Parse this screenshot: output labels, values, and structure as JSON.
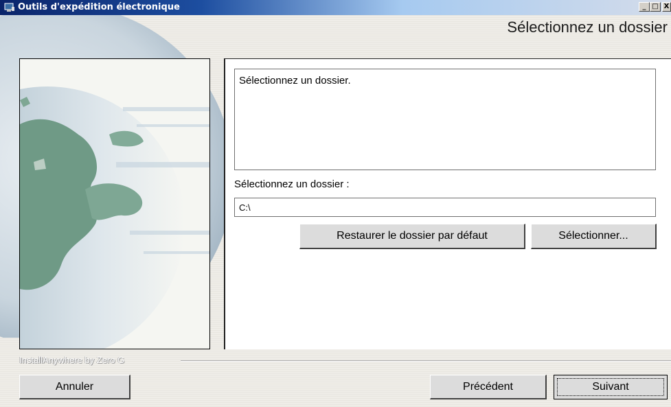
{
  "window": {
    "title": "Outils d'expédition électronique",
    "controls": {
      "minimize": "_",
      "maximize": "□",
      "close": "X"
    }
  },
  "header": {
    "step_title": "Sélectionnez un dossier"
  },
  "content": {
    "message": "Sélectionnez un dossier.",
    "folder_label": "Sélectionnez un dossier :",
    "folder_value": "C:\\",
    "restore_button": "Restaurer le dossier par défaut",
    "select_button": "Sélectionner..."
  },
  "footer": {
    "vendor": "InstallAnywhere by Zero G",
    "cancel_button": "Annuler",
    "previous_button": "Précédent",
    "next_button": "Suivant"
  },
  "colors": {
    "title_bar_start": "#0a246a",
    "title_bar_end": "#d4dcea",
    "globe_sea": "#c8d4dc",
    "globe_land": "#6f9a86"
  },
  "icons": {
    "app_icon": "installer-app-icon",
    "panel_image": "globe-icon"
  }
}
